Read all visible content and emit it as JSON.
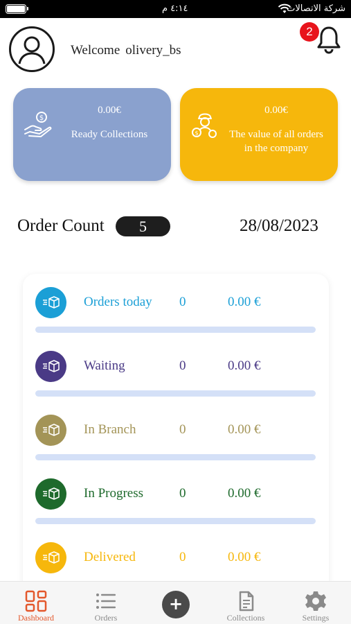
{
  "status_bar": {
    "time": "٤:١٤ م",
    "carrier": "شركة الاتصالات"
  },
  "header": {
    "welcome_text": "Welcome",
    "username": "olivery_bs",
    "notification_count": "2"
  },
  "cards": [
    {
      "amount": "0.00€",
      "label": "Ready Collections",
      "color": "#8aa1ce",
      "icon": "money-hand-icon"
    },
    {
      "amount": "0.00€",
      "label_line1": "The value of all orders",
      "label_line2": "in the company",
      "color": "#f6b70c",
      "icon": "worker-coins-icon"
    }
  ],
  "order_count": {
    "label": "Order Count",
    "value": "5",
    "date": "28/08/2023"
  },
  "order_statuses": [
    {
      "name": "Orders today",
      "count": "0",
      "amount": "0.00 €",
      "color": "#1b9fd6"
    },
    {
      "name": "Waiting",
      "count": "0",
      "amount": "0.00 €",
      "color": "#4a3a86"
    },
    {
      "name": "In Branch",
      "count": "0",
      "amount": "0.00 €",
      "color": "#a39457"
    },
    {
      "name": "In Progress",
      "count": "0",
      "amount": "0.00 €",
      "color": "#1e6a2c"
    },
    {
      "name": "Delivered",
      "count": "0",
      "amount": "0.00 €",
      "color": "#f6b70c"
    }
  ],
  "bottom_nav": [
    {
      "label": "Dashboard",
      "icon": "dashboard-icon",
      "active": true
    },
    {
      "label": "Orders",
      "icon": "list-icon",
      "active": false
    },
    {
      "label": "Collections",
      "icon": "document-icon",
      "active": false
    },
    {
      "label": "Settings",
      "icon": "gear-icon",
      "active": false
    }
  ],
  "fab": {
    "label": "+"
  },
  "colors": {
    "accent": "#e3582c",
    "dark": "#1e1e1e",
    "bar": "#d4e0f7"
  }
}
